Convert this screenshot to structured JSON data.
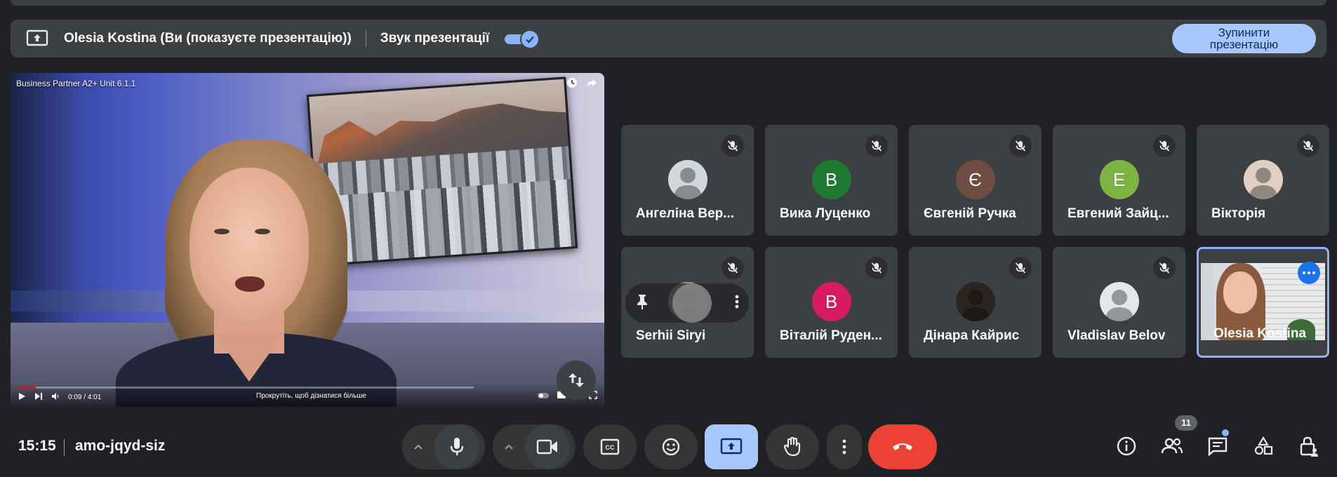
{
  "presenting_bar": {
    "presenter_label": "Olesia Kostina (Ви (показуєте презентацію))",
    "audio_label": "Звук презентації",
    "audio_enabled": true,
    "stop_button": [
      "Зупинити",
      "презентацію"
    ]
  },
  "presentation": {
    "video_title": "Business Partner A2+ Unit 6.1.1",
    "time": "0:09 / 4:01",
    "progress": 0.04,
    "scroll_hint": "Прокрутіть, щоб дізнатися більше"
  },
  "participants": [
    {
      "name": "Ангеліна Вер...",
      "initial": "",
      "avatar_color": "#cfd8dc",
      "muted": true,
      "photo": true
    },
    {
      "name": "Вика Луценко",
      "initial": "В",
      "avatar_color": "#1e7a33",
      "muted": true
    },
    {
      "name": "Євгеній Ручка",
      "initial": "Є",
      "avatar_color": "#6d4c41",
      "muted": true
    },
    {
      "name": "Евгений Зайц...",
      "initial": "Е",
      "avatar_color": "#7cb342",
      "muted": true
    },
    {
      "name": "Вікторія",
      "initial": "",
      "avatar_color": "#e0cfc2",
      "muted": true,
      "photo": true
    },
    {
      "name": "Serhii Siryi",
      "initial": "",
      "avatar_color": "#9e9e9e",
      "muted": true,
      "photo": true
    },
    {
      "name": "Віталій Руден...",
      "initial": "В",
      "avatar_color": "#d81b60",
      "muted": true
    },
    {
      "name": "Дінара Кайрис",
      "initial": "",
      "avatar_color": "#2b2522",
      "muted": true,
      "photo": true
    },
    {
      "name": "Vladislav Belov",
      "initial": "",
      "avatar_color": "#e3e6ea",
      "muted": true,
      "photo": true
    },
    {
      "name": "Olesia Kostina",
      "self": true
    }
  ],
  "bottom_bar": {
    "clock": "15:15",
    "meeting_code": "amo-jqyd-siz",
    "participants_count": "11"
  },
  "colors": {
    "accent": "#8ab4f8",
    "present_active": "#a8c7fa",
    "leave": "#ea4335",
    "tile": "#3c4043",
    "background": "#202124"
  }
}
